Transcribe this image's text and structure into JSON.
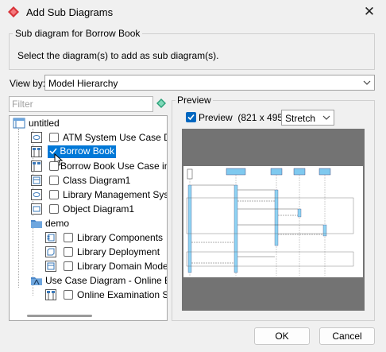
{
  "window": {
    "title": "Add Sub Diagrams",
    "close_glyph": "✕"
  },
  "group": {
    "legend": "Sub diagram for Borrow Book",
    "description": "Select the diagram(s) to add as sub diagram(s)."
  },
  "view_by": {
    "label": "View by:",
    "value": "Model Hierarchy"
  },
  "filter": {
    "placeholder": "Filter"
  },
  "tree": {
    "root": "untitled",
    "items": [
      {
        "label": "ATM System Use Case Diagr",
        "checked": false
      },
      {
        "label": "Borrow Book",
        "checked": true,
        "selected": true
      },
      {
        "label": "Borrow Book Use Case in Lib",
        "checked": false
      },
      {
        "label": "Class Diagram1",
        "checked": false
      },
      {
        "label": "Library Management System",
        "checked": false
      },
      {
        "label": "Object Diagram1",
        "checked": false
      }
    ],
    "demo": {
      "label": "demo",
      "items": [
        {
          "label": "Library Components",
          "checked": false
        },
        {
          "label": "Library Deployment",
          "checked": false
        },
        {
          "label": "Library Domain Model",
          "checked": false
        }
      ]
    },
    "usecase": {
      "label": "Use Case Diagram - Online Exam",
      "items": [
        {
          "label": "Online Examination Syst",
          "checked": false
        }
      ]
    }
  },
  "preview": {
    "legend": "Preview",
    "checkbox_label": "Preview",
    "dimensions": "(821 x 495)",
    "mode": "Stretch"
  },
  "buttons": {
    "ok": "OK",
    "cancel": "Cancel"
  },
  "colors": {
    "accent": "#0078d7",
    "app_icon": "#d9343a"
  }
}
